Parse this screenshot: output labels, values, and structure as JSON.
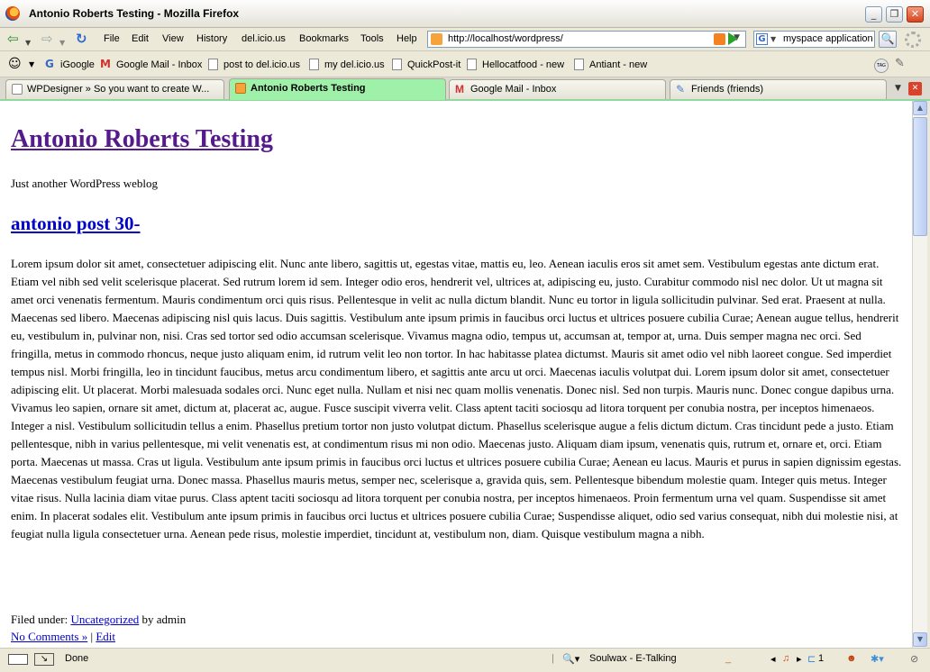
{
  "window": {
    "title": "Antonio Roberts Testing - Mozilla Firefox"
  },
  "menus": [
    "File",
    "Edit",
    "View",
    "History",
    "del.icio.us",
    "Bookmarks",
    "Tools",
    "Help"
  ],
  "url": "http://localhost/wordpress/",
  "search": {
    "value": "myspace application"
  },
  "bookmarks": [
    "iGoogle",
    "Google Mail - Inbox",
    "post to del.icio.us",
    "my del.icio.us",
    "QuickPost-it",
    "Hellocatfood - new",
    "Antiant - new"
  ],
  "tabs": [
    {
      "label": "WPDesigner » So you want to create W..."
    },
    {
      "label": "Antonio Roberts Testing"
    },
    {
      "label": "Google Mail - Inbox"
    },
    {
      "label": "Friends (friends)"
    }
  ],
  "page": {
    "site_title": "Antonio Roberts Testing",
    "tagline": "Just another WordPress weblog",
    "post_title": "antonio post 30-",
    "post_body": "Lorem ipsum dolor sit amet, consectetuer adipiscing elit. Nunc ante libero, sagittis ut, egestas vitae, mattis eu, leo. Aenean iaculis eros sit amet sem. Vestibulum egestas ante dictum erat. Etiam vel nibh sed velit scelerisque placerat. Sed rutrum lorem id sem. Integer odio eros, hendrerit vel, ultrices at, adipiscing eu, justo. Curabitur commodo nisl nec dolor. Ut ut magna sit amet orci venenatis fermentum. Mauris condimentum orci quis risus. Pellentesque in velit ac nulla dictum blandit. Nunc eu tortor in ligula sollicitudin pulvinar. Sed erat. Praesent at nulla. Maecenas sed libero. Maecenas adipiscing nisl quis lacus. Duis sagittis. Vestibulum ante ipsum primis in faucibus orci luctus et ultrices posuere cubilia Curae; Aenean augue tellus, hendrerit eu, vestibulum in, pulvinar non, nisi. Cras sed tortor sed odio accumsan scelerisque. Vivamus magna odio, tempus ut, accumsan at, tempor at, urna. Duis semper magna nec orci. Sed fringilla, metus in commodo rhoncus, neque justo aliquam enim, id rutrum velit leo non tortor. In hac habitasse platea dictumst. Mauris sit amet odio vel nibh laoreet congue. Sed imperdiet tempus nisl. Morbi fringilla, leo in tincidunt faucibus, metus arcu condimentum libero, et sagittis ante arcu ut orci. Maecenas iaculis volutpat dui. Lorem ipsum dolor sit amet, consectetuer adipiscing elit. Ut placerat. Morbi malesuada sodales orci. Nunc eget nulla. Nullam et nisi nec quam mollis venenatis. Donec nisl. Sed non turpis. Mauris nunc. Donec congue dapibus urna. Vivamus leo sapien, ornare sit amet, dictum at, placerat ac, augue. Fusce suscipit viverra velit. Class aptent taciti sociosqu ad litora torquent per conubia nostra, per inceptos himenaeos. Integer a nisl. Vestibulum sollicitudin tellus a enim. Phasellus pretium tortor non justo volutpat dictum. Phasellus scelerisque augue a felis dictum dictum. Cras tincidunt pede a justo. Etiam pellentesque, nibh in varius pellentesque, mi velit venenatis est, at condimentum risus mi non odio. Maecenas justo. Aliquam diam ipsum, venenatis quis, rutrum et, ornare et, orci. Etiam porta. Maecenas ut massa. Cras ut ligula. Vestibulum ante ipsum primis in faucibus orci luctus et ultrices posuere cubilia Curae; Aenean eu lacus. Mauris et purus in sapien dignissim egestas. Maecenas vestibulum feugiat urna. Donec massa. Phasellus mauris metus, semper nec, scelerisque a, gravida quis, sem. Pellentesque bibendum molestie quam. Integer quis metus. Integer vitae risus. Nulla lacinia diam vitae purus. Class aptent taciti sociosqu ad litora torquent per conubia nostra, per inceptos himenaeos. Proin fermentum urna vel quam. Suspendisse sit amet enim. In placerat sodales elit. Vestibulum ante ipsum primis in faucibus orci luctus et ultrices posuere cubilia Curae; Suspendisse aliquet, odio sed varius consequat, nibh dui molestie nisi, at feugiat nulla ligula consectetuer urna. Aenean pede risus, molestie imperdiet, tincidunt at, vestibulum non, diam. Quisque vestibulum magna a nibh.",
    "filed_prefix": "Filed under:",
    "category": "Uncategorized",
    "by_author": "by admin",
    "comments_link": "No Comments »",
    "separator": "|",
    "edit_link": "Edit"
  },
  "status": {
    "text": "Done",
    "now_playing": "Soulwax - E-Talking",
    "tab_count": "1"
  }
}
